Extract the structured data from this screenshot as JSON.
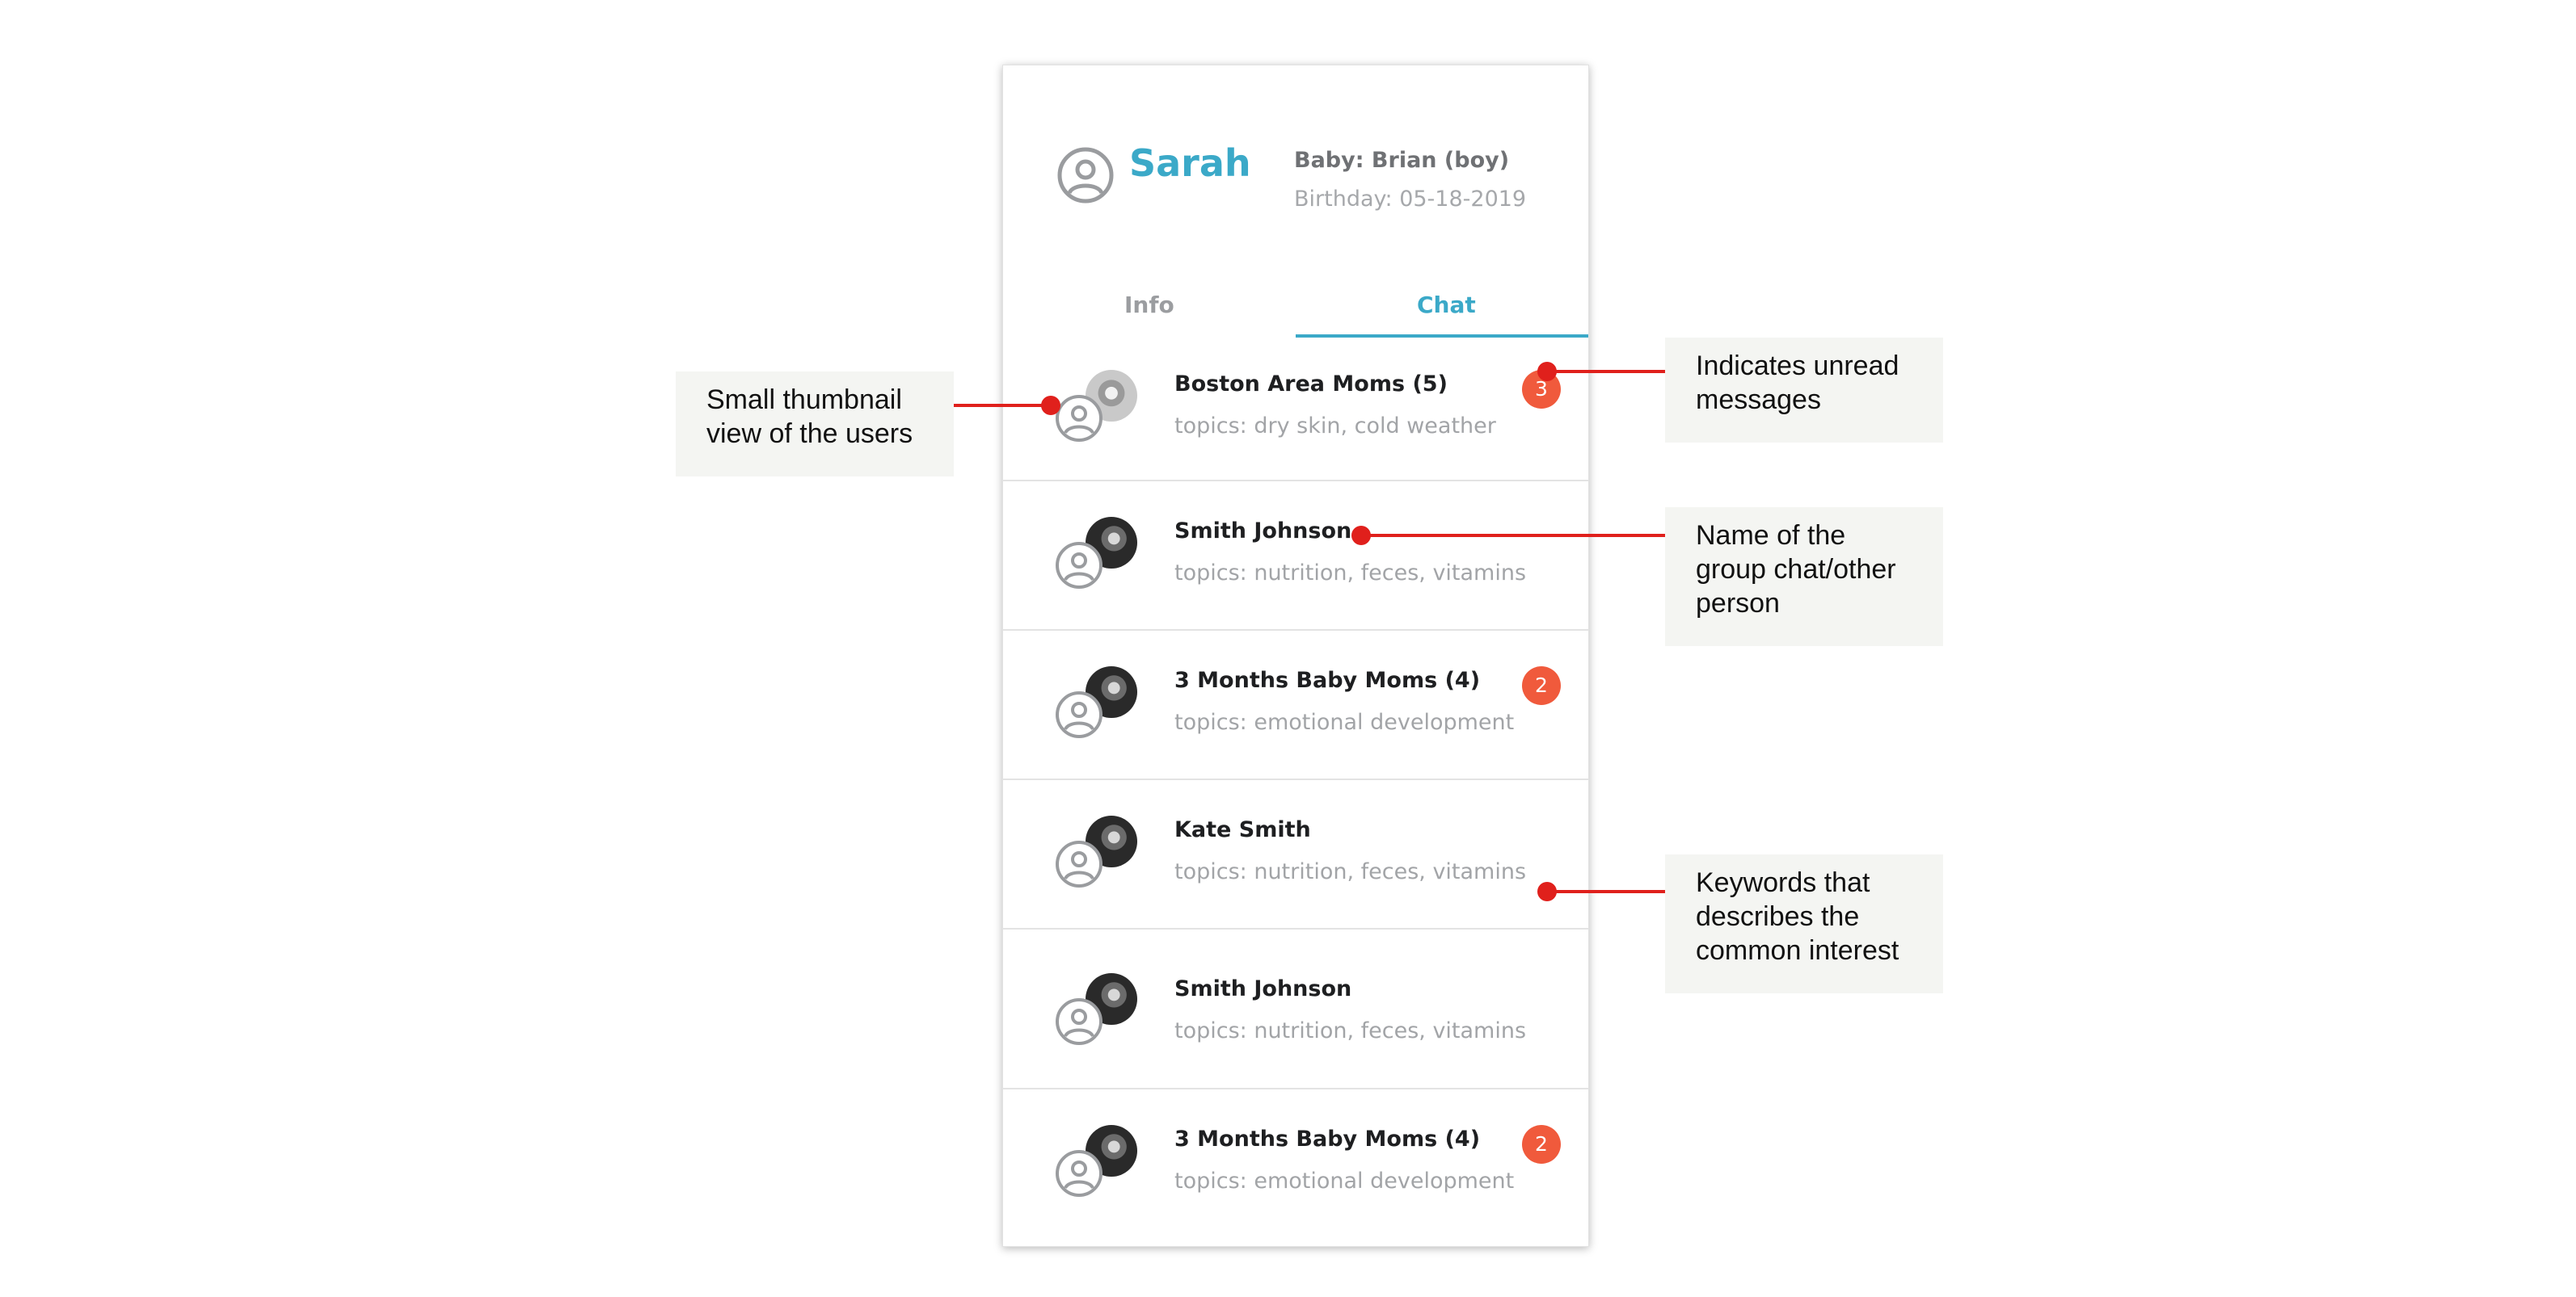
{
  "profile": {
    "name": "Sarah",
    "baby": "Baby: Brian (boy)",
    "birthday": "Birthday: 05-18-2019"
  },
  "tabs": [
    {
      "label": "Info"
    },
    {
      "label": "Chat"
    }
  ],
  "chats": [
    {
      "name": "Boston Area Moms (5)",
      "topics": "topics: dry skin, cold weather",
      "unread": "3"
    },
    {
      "name": "Smith Johnson",
      "topics": "topics: nutrition, feces, vitamins",
      "unread": ""
    },
    {
      "name": "3 Months Baby Moms (4)",
      "topics": "topics: emotional development",
      "unread": "2"
    },
    {
      "name": "Kate Smith",
      "topics": "topics: nutrition, feces, vitamins",
      "unread": ""
    },
    {
      "name": "Smith Johnson",
      "topics": "topics: nutrition, feces, vitamins",
      "unread": ""
    },
    {
      "name": "3 Months Baby Moms (4)",
      "topics": "topics: emotional development",
      "unread": "2"
    }
  ],
  "annotations": {
    "thumbnail": "Small thumbnail view of the users",
    "unread": "Indicates unread messages",
    "name": "Name of the group chat/other person",
    "keywords": "Keywords that describes the common interest"
  },
  "colors": {
    "accent": "#3ba9c8",
    "badge": "#f05a3c",
    "annotation_line": "#e0201c",
    "annotation_bg": "#f4f5f2"
  },
  "icons": {
    "profile": "user-circle-icon",
    "member": "user-circle-icon",
    "thumbnail": "photo-avatar"
  }
}
